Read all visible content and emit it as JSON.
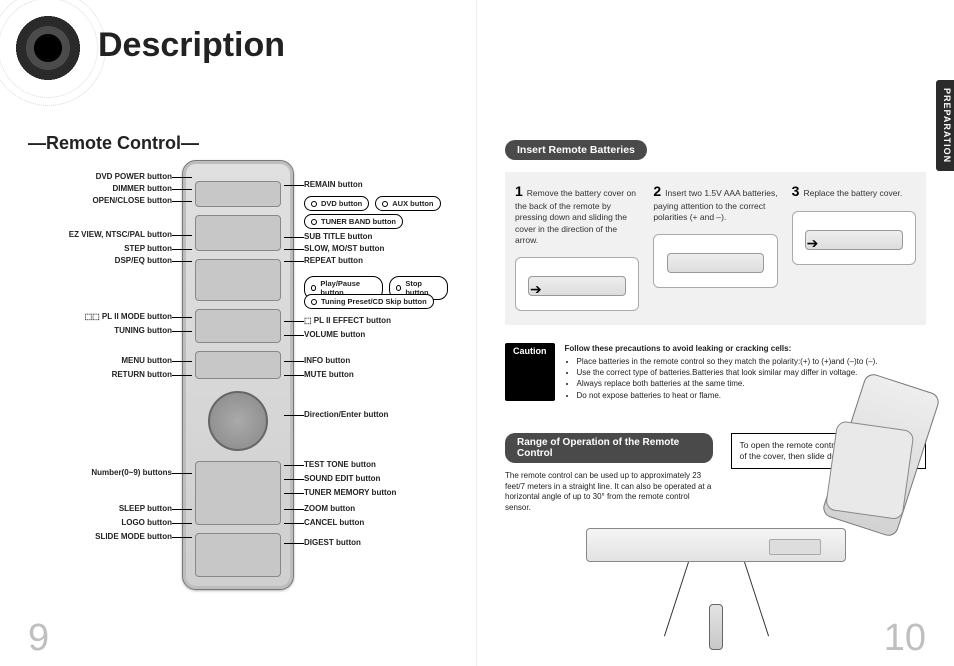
{
  "doc": {
    "title": "Description",
    "section_tab": "PREPARATION",
    "page_left": "9",
    "page_right": "10"
  },
  "remote": {
    "heading": "—Remote Control—",
    "labels_left": [
      "DVD POWER button",
      "DIMMER button",
      "OPEN/CLOSE button",
      "EZ VIEW, NTSC/PAL button",
      "STEP button",
      "DSP/EQ button",
      "⬚⬚ PL II MODE button",
      "TUNING button",
      "MENU button",
      "RETURN button",
      "Number(0~9) buttons",
      "SLEEP button",
      "LOGO button",
      "SLIDE MODE button"
    ],
    "labels_right": [
      "REMAIN button",
      "SUB TITLE button",
      "SLOW, MO/ST button",
      "REPEAT button",
      "⬚ PL II EFFECT button",
      "VOLUME button",
      "INFO button",
      "MUTE button",
      "Direction/Enter button",
      "TEST TONE button",
      "SOUND EDIT button",
      "TUNER MEMORY button",
      "ZOOM button",
      "CANCEL button",
      "DIGEST button"
    ],
    "callouts": {
      "row1": {
        "a": "DVD button",
        "b": "AUX button"
      },
      "row1b": "TUNER BAND button",
      "row2": {
        "a": "Play/Pause button",
        "b": "Stop button"
      },
      "row2b": "Tuning Preset/CD Skip button"
    }
  },
  "batteries": {
    "heading": "Insert Remote Batteries",
    "steps": [
      {
        "n": "1",
        "text": "Remove the battery cover on the back of the remote by pressing down and sliding the cover in the direction of the arrow."
      },
      {
        "n": "2",
        "text": "Insert two 1.5V AAA batteries, paying attention to the correct polarities (+ and –)."
      },
      {
        "n": "3",
        "text": "Replace the battery cover."
      }
    ],
    "caution_label": "Caution",
    "caution_lead": "Follow these precautions to avoid leaking or cracking cells:",
    "caution_items": [
      "Place batteries in the remote control so they match the polarity:(+) to (+)and (–)to (–).",
      "Use the correct type of batteries.Batteries that look similar may differ in voltage.",
      "Always replace both batteries at the same time.",
      "Do not expose batteries to heat or flame."
    ]
  },
  "range": {
    "heading": "Range of Operation of the Remote Control",
    "text": "The remote control can be used up to approximately 23 feet/7 meters in a straight line. It can also be operated at a horizontal angle of up to 30° from the remote control sensor.",
    "note": "To open the remote control cover, push the top of the cover, then slide downward."
  }
}
